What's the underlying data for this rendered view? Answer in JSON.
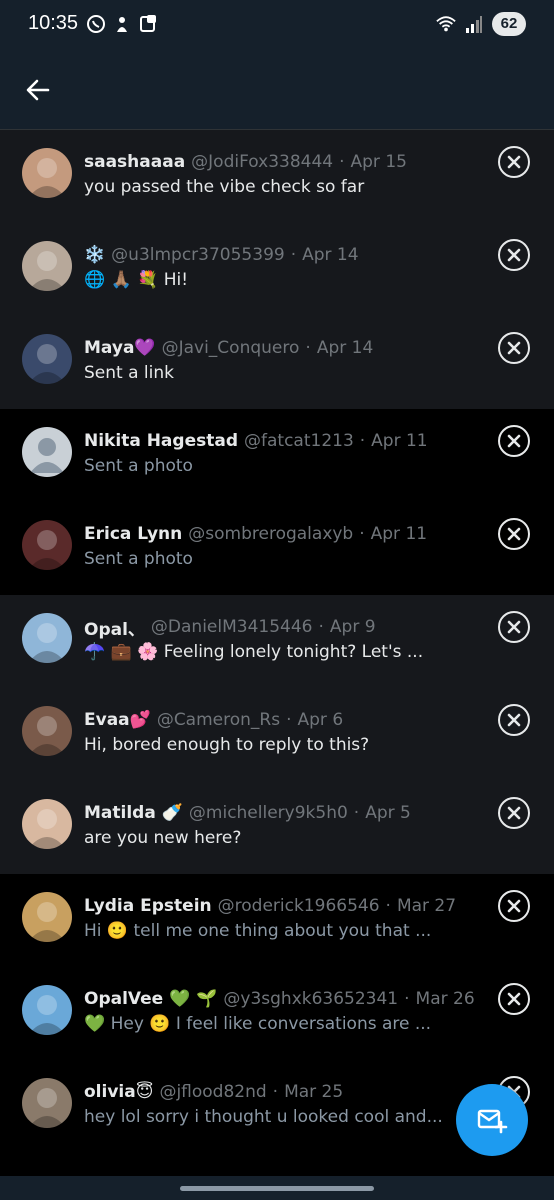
{
  "status_bar": {
    "time": "10:35",
    "battery": "62",
    "left_icons": [
      "whatsapp-icon",
      "hand-icon",
      "notification-icon"
    ],
    "right_icons": [
      "wifi-icon",
      "signal-icon"
    ]
  },
  "header": {
    "back_icon": "arrow-left-icon"
  },
  "conversations": [
    {
      "name": "saashaaaa",
      "handle": "@JodiFox338444",
      "date": "Apr 15",
      "message": "you passed the vibe check so far",
      "avatar_color": "#c49a7e"
    },
    {
      "name": "❄️",
      "handle": "@u3lmpcr37055399",
      "date": "Apr 14",
      "message": "🌐 🙏🏽 💐 Hi!",
      "avatar_color": "#b7a89a"
    },
    {
      "name": "Maya💜",
      "handle": "@Javi_Conquero",
      "date": "Apr 14",
      "message": "Sent a link",
      "avatar_color": "#3a4a6b"
    },
    {
      "name": "Nikita Hagestad",
      "handle": "@fatcat1213",
      "date": "Apr 11",
      "message": "Sent a photo",
      "avatar_color": "#c9d0d6"
    },
    {
      "name": "Erica Lynn",
      "handle": "@sombrerogalaxyb",
      "date": "Apr 11",
      "message": "Sent a photo",
      "avatar_color": "#5a2a2a"
    },
    {
      "name": "Opal、",
      "handle": "@DanielM3415446",
      "date": "Apr 9",
      "message": "☂️ 💼 🌸 Feeling lonely tonight? Let's ...",
      "avatar_color": "#8fb6d8"
    },
    {
      "name": "Evaa💕",
      "handle": "@Cameron_Rs",
      "date": "Apr 6",
      "message": "Hi, bored enough to reply to this?",
      "avatar_color": "#7a5a4a"
    },
    {
      "name": "Matilda 🍼",
      "handle": "@michellery9k5h0",
      "date": "Apr 5",
      "message": "are you new here?",
      "avatar_color": "#d8b8a0"
    },
    {
      "name": "Lydia Epstein",
      "handle": "@roderick1966546",
      "date": "Mar 27",
      "message": "Hi 🙂 tell me one thing about you that ...",
      "avatar_color": "#c8a060"
    },
    {
      "name": "OpalVee 💚 🌱",
      "handle": "@y3sghxk63652341",
      "date": "Mar 26",
      "message": "💚 Hey 🙂 I feel like conversations are ...",
      "avatar_color": "#6aa8d8"
    },
    {
      "name": "olivia😇",
      "handle": "@jflood82nd",
      "date": "Mar 25",
      "message": "hey lol sorry i thought u looked cool and...",
      "avatar_color": "#8a7a6a"
    }
  ],
  "separator": "·",
  "fab_icon": "new-message-icon",
  "colors": {
    "accent": "#1d9bf0",
    "background": "#000000",
    "header": "#15202b",
    "muted": "#71767b"
  }
}
